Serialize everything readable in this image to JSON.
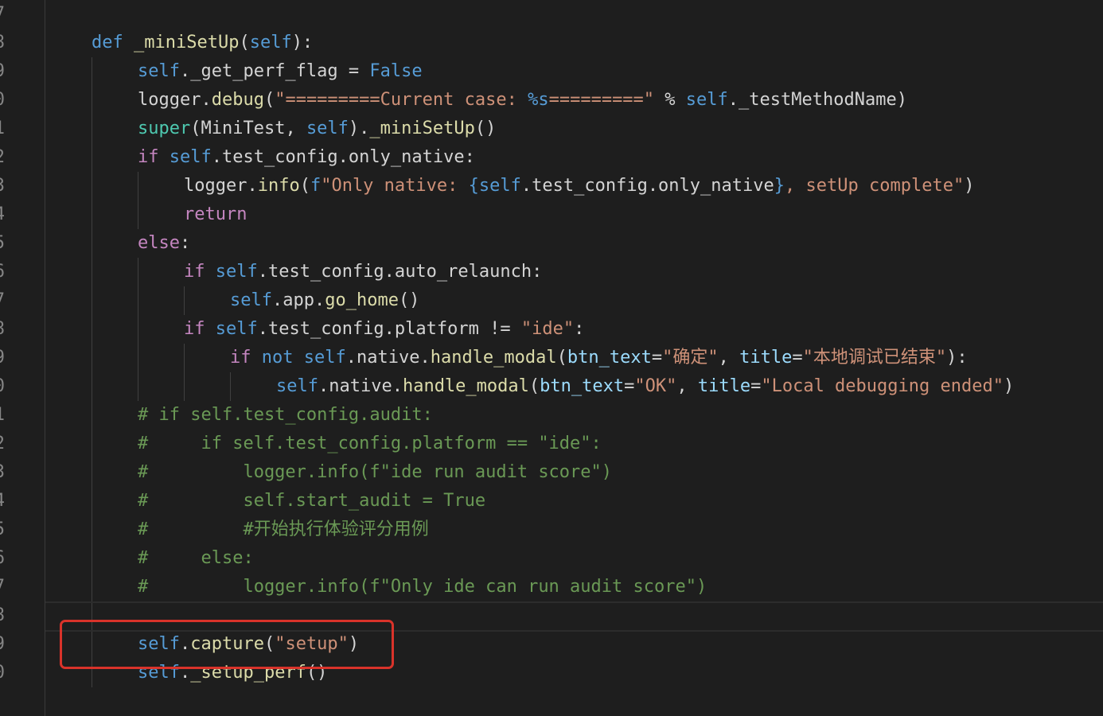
{
  "gutter": {
    "line_numbers": [
      "7",
      "8",
      "9",
      "0",
      "1",
      "2",
      "3",
      "4",
      "5",
      "6",
      "7",
      "8",
      "9",
      "0",
      "1",
      "2",
      "3",
      "4",
      "5",
      "6",
      "7",
      "8",
      "9",
      "0"
    ]
  },
  "code": {
    "lines": [
      [
        {
          "t": "def",
          "c": "kw"
        },
        {
          "t": " ",
          "c": "plain"
        },
        {
          "t": "_miniSetUp",
          "c": "fn"
        },
        {
          "t": "(",
          "c": "plain"
        },
        {
          "t": "self",
          "c": "self"
        },
        {
          "t": "):",
          "c": "plain"
        }
      ],
      [
        {
          "t": "self",
          "c": "self"
        },
        {
          "t": "._get_perf_flag = ",
          "c": "plain"
        },
        {
          "t": "False",
          "c": "kw"
        }
      ],
      [
        {
          "t": "logger.",
          "c": "plain"
        },
        {
          "t": "debug",
          "c": "fn"
        },
        {
          "t": "(",
          "c": "plain"
        },
        {
          "t": "\"=========Current case: ",
          "c": "str"
        },
        {
          "t": "%s",
          "c": "fmt"
        },
        {
          "t": "=========\"",
          "c": "str"
        },
        {
          "t": " % ",
          "c": "plain"
        },
        {
          "t": "self",
          "c": "self"
        },
        {
          "t": "._testMethodName)",
          "c": "plain"
        }
      ],
      [
        {
          "t": "super",
          "c": "cls"
        },
        {
          "t": "(MiniTest, ",
          "c": "plain"
        },
        {
          "t": "self",
          "c": "self"
        },
        {
          "t": ").",
          "c": "plain"
        },
        {
          "t": "_miniSetUp",
          "c": "fn"
        },
        {
          "t": "()",
          "c": "plain"
        }
      ],
      [
        {
          "t": "if",
          "c": "kw-ctrl"
        },
        {
          "t": " ",
          "c": "plain"
        },
        {
          "t": "self",
          "c": "self"
        },
        {
          "t": ".test_config.only_native:",
          "c": "plain"
        }
      ],
      [
        {
          "t": "logger.",
          "c": "plain"
        },
        {
          "t": "info",
          "c": "fn"
        },
        {
          "t": "(",
          "c": "plain"
        },
        {
          "t": "f",
          "c": "kw"
        },
        {
          "t": "\"Only native: ",
          "c": "str"
        },
        {
          "t": "{",
          "c": "kw"
        },
        {
          "t": "self",
          "c": "self"
        },
        {
          "t": ".test_config.only_native",
          "c": "plain"
        },
        {
          "t": "}",
          "c": "kw"
        },
        {
          "t": ", setUp complete\"",
          "c": "str"
        },
        {
          "t": ")",
          "c": "plain"
        }
      ],
      [
        {
          "t": "return",
          "c": "kw-ctrl"
        }
      ],
      [
        {
          "t": "else",
          "c": "kw-ctrl"
        },
        {
          "t": ":",
          "c": "plain"
        }
      ],
      [
        {
          "t": "if",
          "c": "kw-ctrl"
        },
        {
          "t": " ",
          "c": "plain"
        },
        {
          "t": "self",
          "c": "self"
        },
        {
          "t": ".test_config.auto_relaunch:",
          "c": "plain"
        }
      ],
      [
        {
          "t": "self",
          "c": "self"
        },
        {
          "t": ".app.",
          "c": "plain"
        },
        {
          "t": "go_home",
          "c": "fn"
        },
        {
          "t": "()",
          "c": "plain"
        }
      ],
      [
        {
          "t": "if",
          "c": "kw-ctrl"
        },
        {
          "t": " ",
          "c": "plain"
        },
        {
          "t": "self",
          "c": "self"
        },
        {
          "t": ".test_config.platform != ",
          "c": "plain"
        },
        {
          "t": "\"ide\"",
          "c": "str"
        },
        {
          "t": ":",
          "c": "plain"
        }
      ],
      [
        {
          "t": "if",
          "c": "kw-ctrl"
        },
        {
          "t": " ",
          "c": "plain"
        },
        {
          "t": "not",
          "c": "kw"
        },
        {
          "t": " ",
          "c": "plain"
        },
        {
          "t": "self",
          "c": "self"
        },
        {
          "t": ".native.",
          "c": "plain"
        },
        {
          "t": "handle_modal",
          "c": "fn"
        },
        {
          "t": "(",
          "c": "plain"
        },
        {
          "t": "btn_text",
          "c": "param"
        },
        {
          "t": "=",
          "c": "plain"
        },
        {
          "t": "\"确定\"",
          "c": "str"
        },
        {
          "t": ", ",
          "c": "plain"
        },
        {
          "t": "title",
          "c": "param"
        },
        {
          "t": "=",
          "c": "plain"
        },
        {
          "t": "\"本地调试已结束\"",
          "c": "str"
        },
        {
          "t": "):",
          "c": "plain"
        }
      ],
      [
        {
          "t": "self",
          "c": "self"
        },
        {
          "t": ".native.",
          "c": "plain"
        },
        {
          "t": "handle_modal",
          "c": "fn"
        },
        {
          "t": "(",
          "c": "plain"
        },
        {
          "t": "btn_text",
          "c": "param"
        },
        {
          "t": "=",
          "c": "plain"
        },
        {
          "t": "\"OK\"",
          "c": "str"
        },
        {
          "t": ", ",
          "c": "plain"
        },
        {
          "t": "title",
          "c": "param"
        },
        {
          "t": "=",
          "c": "plain"
        },
        {
          "t": "\"Local debugging ended\"",
          "c": "str"
        },
        {
          "t": ")",
          "c": "plain"
        }
      ],
      [
        {
          "t": "# if self.test_config.audit:",
          "c": "cmt"
        }
      ],
      [
        {
          "t": "#     if self.test_config.platform == \"ide\":",
          "c": "cmt"
        }
      ],
      [
        {
          "t": "#         logger.info(f\"ide run audit score\")",
          "c": "cmt"
        }
      ],
      [
        {
          "t": "#         self.start_audit = True",
          "c": "cmt"
        }
      ],
      [
        {
          "t": "#         #开始执行体验评分用例",
          "c": "cmt"
        }
      ],
      [
        {
          "t": "#     else:",
          "c": "cmt"
        }
      ],
      [
        {
          "t": "#         logger.info(f\"Only ide can run audit score\")",
          "c": "cmt"
        }
      ],
      [],
      [
        {
          "t": "self",
          "c": "self"
        },
        {
          "t": ".",
          "c": "plain"
        },
        {
          "t": "capture",
          "c": "fn"
        },
        {
          "t": "(",
          "c": "plain"
        },
        {
          "t": "\"setup\"",
          "c": "str"
        },
        {
          "t": ")",
          "c": "plain"
        }
      ],
      [
        {
          "t": "self",
          "c": "self"
        },
        {
          "t": ".",
          "c": "plain"
        },
        {
          "t": "_setup_perf",
          "c": "fn"
        },
        {
          "t": "()",
          "c": "plain"
        }
      ]
    ]
  },
  "colors": {
    "background": "#1e1e1e",
    "keyword": "#569cd6",
    "control_keyword": "#c586c0",
    "function": "#dcdcaa",
    "class": "#4ec9b0",
    "string": "#ce9178",
    "parameter": "#9cdcfe",
    "comment": "#6a9955",
    "text": "#d4d4d4",
    "highlight_box": "#d9332a"
  }
}
